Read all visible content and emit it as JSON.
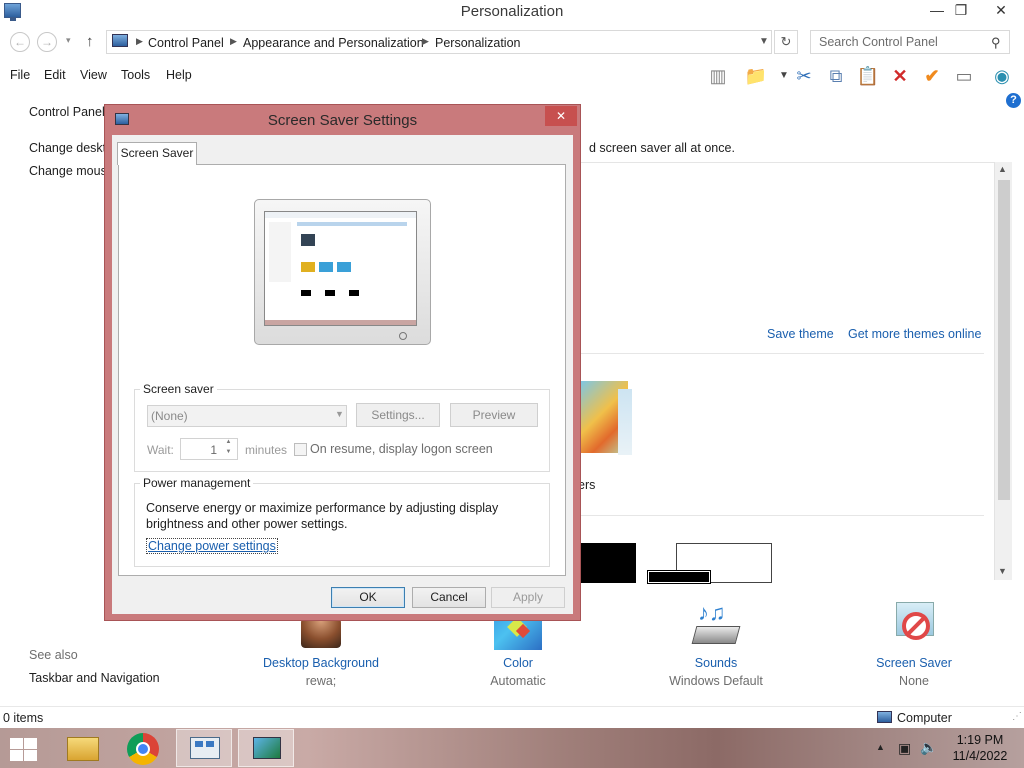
{
  "window": {
    "title": "Personalization",
    "min_glyph": "—",
    "max_glyph": "❐",
    "close_glyph": "✕"
  },
  "address": {
    "crumbs": [
      "Control Panel",
      "Appearance and Personalization",
      "Personalization"
    ],
    "search_placeholder": "Search Control Panel"
  },
  "menu": [
    "File",
    "Edit",
    "View",
    "Tools",
    "Help"
  ],
  "background": {
    "sidebar_home": "Control Panel",
    "sidebar_link1": "Change deskto",
    "sidebar_link2": "Change mous",
    "header_text_tail": "d screen saver all at once.",
    "save_theme": "Save theme",
    "more_themes": "Get more themes online",
    "theme_caption_tail": "ers",
    "see_also": "See also",
    "taskbar_nav": "Taskbar and Navigation",
    "bottom_items": [
      {
        "label": "Desktop Background",
        "sub": "rewa;"
      },
      {
        "label": "Color",
        "sub": "Automatic"
      },
      {
        "label": "Sounds",
        "sub": "Windows Default"
      },
      {
        "label": "Screen Saver",
        "sub": "None"
      }
    ]
  },
  "status": {
    "count": "0 items",
    "computer": "Computer"
  },
  "taskbar": {
    "time": "1:19 PM",
    "date": "11/4/2022"
  },
  "dialog": {
    "title": "Screen Saver Settings",
    "tab": "Screen Saver",
    "screen_saver_group": "Screen saver",
    "screen_saver_value": "(None)",
    "settings_button": "Settings...",
    "preview_button": "Preview",
    "wait_label": "Wait:",
    "wait_value": "1",
    "minutes_label": "minutes",
    "resume_label": "On resume, display logon screen",
    "power_group": "Power management",
    "power_text": "Conserve energy or maximize performance by adjusting display brightness and other power settings.",
    "power_link": "Change power settings",
    "ok": "OK",
    "cancel": "Cancel",
    "apply": "Apply"
  }
}
